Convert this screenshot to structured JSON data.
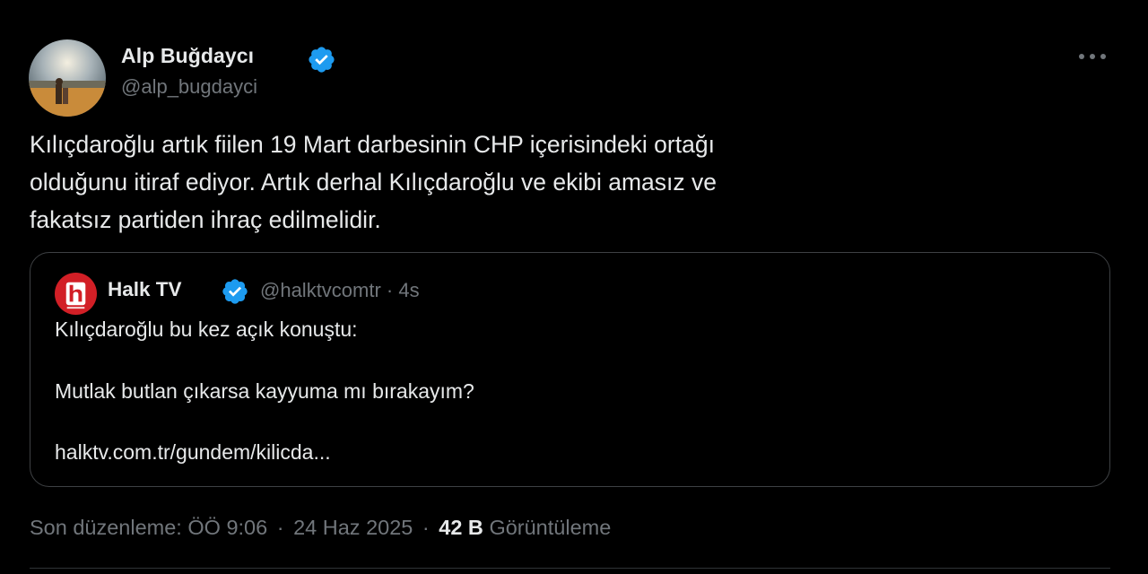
{
  "author": {
    "display_name": "Alp Buğdaycı",
    "handle": "@alp_bugdayci",
    "verified_icon": "verified-badge-icon",
    "avatar_icon": "profile-photo"
  },
  "more_icon": "more-options-icon",
  "tweet": {
    "lines": [
      "Kılıçdaroğlu artık fiilen 19 Mart darbesinin CHP içerisindeki ortağı",
      "olduğunu itiraf ediyor. Artık derhal Kılıçdaroğlu ve ekibi amasız ve",
      "fakatsız partiden ihraç edilmelidir."
    ]
  },
  "quote": {
    "display_name": "Halk TV",
    "meta": "@halktvcomtr · 4s",
    "avatar_icon": "halktv-logo",
    "lines": [
      "Kılıçdaroğlu bu kez açık konuştu:",
      "Mutlak butlan çıkarsa kayyuma mı bırakayım?",
      "halktv.com.tr/gundem/kilicda..."
    ]
  },
  "footer": {
    "edited": "Son düzenleme: ÖÖ 9:06",
    "date": "24 Haz 2025",
    "separator": "·",
    "views_count": "42 B",
    "views_label": "Görüntüleme"
  },
  "colors": {
    "background": "#000000",
    "text": "#e7e9ea",
    "muted": "#71767b",
    "verified": "#1d9bf0",
    "border": "#3e4144",
    "halktv_red": "#d21f26"
  }
}
